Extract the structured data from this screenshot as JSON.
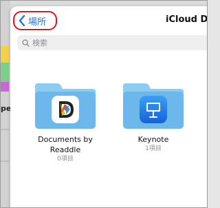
{
  "background_fragment": {
    "text": "pe"
  },
  "nav": {
    "back_label": "場所",
    "title": "iCloud D"
  },
  "search": {
    "placeholder": "検索"
  },
  "items": [
    {
      "title": "Documents by\nReaddle",
      "title_line1": "Documents by",
      "title_line2": "Readdle",
      "subtitle": "0項目"
    },
    {
      "title": "Keynote",
      "subtitle": "1項目"
    }
  ],
  "colors": {
    "accent": "#1a73e8",
    "highlight": "#e0111b",
    "folder": "#6cb8ea",
    "folder_light": "#8fcaf1"
  },
  "icons": [
    "chevron-left-icon",
    "search-icon",
    "folder-icon",
    "documents-app-icon",
    "keynote-app-icon"
  ]
}
